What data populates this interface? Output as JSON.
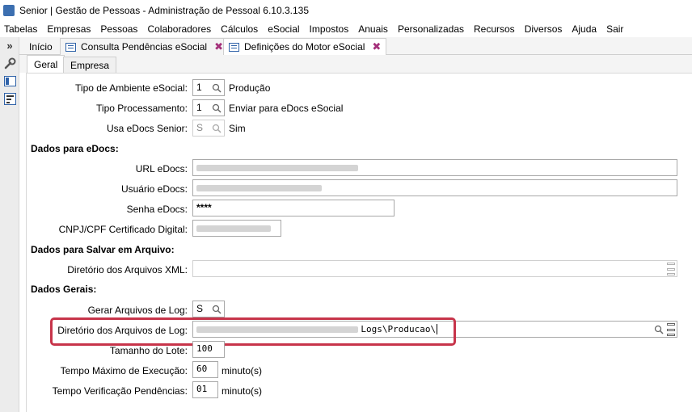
{
  "window": {
    "title": "Senior | Gestão de Pessoas - Administração de Pessoal 6.10.3.135"
  },
  "menu": [
    "Tabelas",
    "Empresas",
    "Pessoas",
    "Colaboradores",
    "Cálculos",
    "eSocial",
    "Impostos",
    "Anuais",
    "Personalizadas",
    "Recursos",
    "Diversos",
    "Ajuda",
    "Sair"
  ],
  "tabs": {
    "chevron": "»",
    "inicio": "Início",
    "consulta": "Consulta Pendências eSocial",
    "definicoes": "Definições do Motor eSocial",
    "close": "✖"
  },
  "subtabs": {
    "geral": "Geral",
    "empresa": "Empresa"
  },
  "form": {
    "tipo_ambiente": {
      "label": "Tipo de Ambiente eSocial:",
      "value": "1",
      "desc": "Produção"
    },
    "tipo_processamento": {
      "label": "Tipo Processamento:",
      "value": "1",
      "desc": "Enviar para eDocs eSocial"
    },
    "usa_edocs": {
      "label": "Usa eDocs Senior:",
      "value": "S",
      "desc": "Sim"
    },
    "section_edocs": "Dados para eDocs:",
    "url_edocs": {
      "label": "URL eDocs:"
    },
    "usuario_edocs": {
      "label": "Usuário eDocs:"
    },
    "senha_edocs": {
      "label": "Senha eDocs:",
      "value": "****"
    },
    "cnpj_cert": {
      "label": "CNPJ/CPF Certificado Digital:"
    },
    "section_arquivo": "Dados para Salvar em Arquivo:",
    "dir_xml": {
      "label": "Diretório dos Arquivos XML:",
      "value": ""
    },
    "section_gerais": "Dados Gerais:",
    "gerar_log": {
      "label": "Gerar Arquivos de Log:",
      "value": "S"
    },
    "dir_log": {
      "label": "Diretório dos Arquivos de Log:",
      "value_suffix": "Logs\\Producao\\"
    },
    "tamanho_lote": {
      "label": "Tamanho do Lote:",
      "value": "100"
    },
    "tempo_exec": {
      "label": "Tempo Máximo de Execução:",
      "value": "60",
      "unit": "minuto(s)"
    },
    "tempo_verif": {
      "label": "Tempo Verificação Pendências:",
      "value": "01",
      "unit": "minuto(s)"
    }
  },
  "icons": {
    "search": "🔍",
    "wrench": "🔧"
  },
  "colors": {
    "highlight": "#c7344a",
    "tab_close": "#a4307a",
    "icon_blue": "#2f62a8"
  }
}
